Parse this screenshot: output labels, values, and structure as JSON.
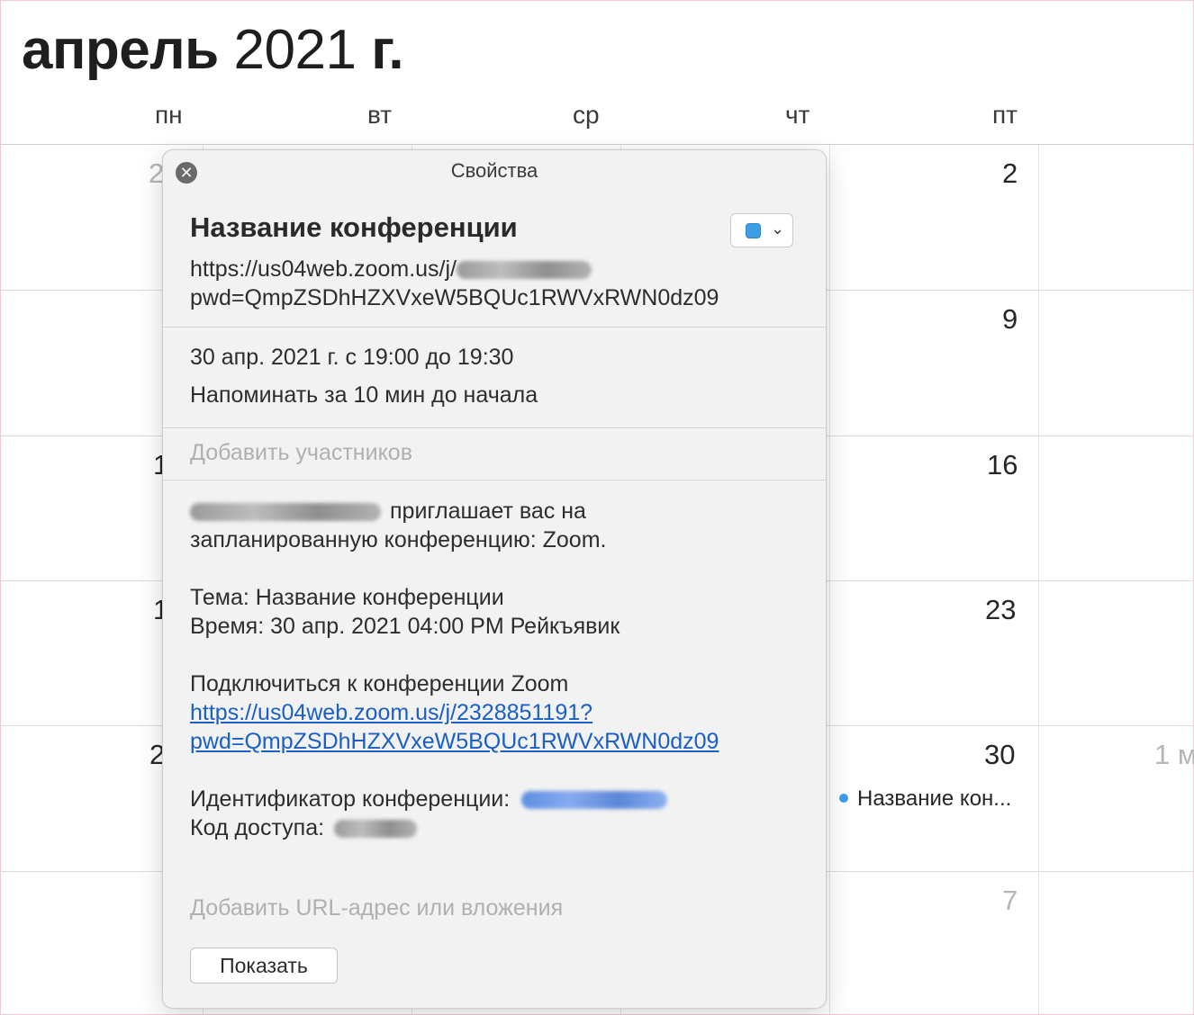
{
  "calendar": {
    "title_month": "апрель",
    "title_year": "2021",
    "title_suffix": "г.",
    "weekdays": [
      "пн",
      "вт",
      "ср",
      "чт",
      "пт"
    ],
    "day_numbers": {
      "mon_row1": "2",
      "fri_row1": "2",
      "fri_row2": "9",
      "mon_row3": "1",
      "fri_row3": "16",
      "mon_row4": "1",
      "fri_row4": "23",
      "mon_row5": "2",
      "fri_row5": "30",
      "sat_row5": "1 м",
      "fri_row6": "7"
    },
    "event_label": "Название кон..."
  },
  "popover": {
    "header": "Свойства",
    "close_icon": "close-icon",
    "title": "Название конференции",
    "color_accent": "#3d9ee6",
    "url_line1": "https://us04web.zoom.us/j/",
    "url_line2": "pwd=QmpZSDhHZXVxeW5BQUc1RWVxRWN0dz09",
    "datetime": "30 апр. 2021 г. с 19:00 до 19:30",
    "reminder": "Напоминать за 10 мин до начала",
    "add_participants": "Добавить участников",
    "invite_text": "приглашает вас на",
    "invite_text2": "запланированную конференцию: Zoom.",
    "topic": "Тема: Название конференции",
    "time": "Время: 30 апр. 2021 04:00 PM Рейкъявик",
    "join": "Подключиться к конференции Zoom",
    "join_link1": "https://us04web.zoom.us/j/2328851191?",
    "join_link2": "pwd=QmpZSDhHZXVxeW5BQUc1RWVxRWN0dz09",
    "conf_id_label": "Идентификатор конференции:",
    "passcode_label": "Код доступа:",
    "add_url": "Добавить URL-адрес или вложения",
    "show_button": "Показать"
  }
}
